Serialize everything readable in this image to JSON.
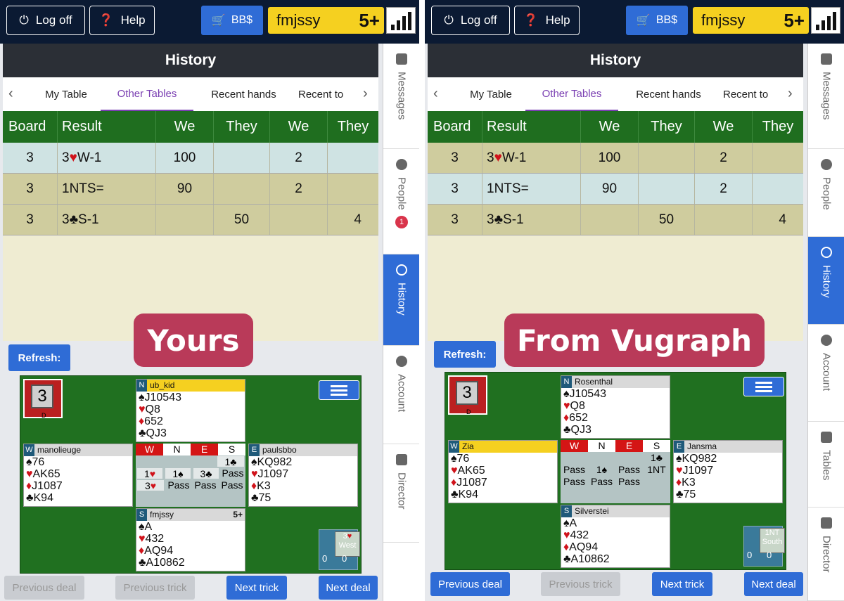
{
  "top": {
    "logoff": "Log off",
    "help": "Help",
    "bb": "BB$",
    "username": "fmjssy",
    "rank": "5+"
  },
  "history_title": "History",
  "tabs": [
    "My Table",
    "Other Tables",
    "Recent hands",
    "Recent to"
  ],
  "columns": [
    "Board",
    "Result",
    "We",
    "They",
    "We",
    "They"
  ],
  "sidebar": {
    "messages": "Messages",
    "people": "People",
    "people_badge": "1",
    "history": "History",
    "account": "Account",
    "tables": "Tables",
    "director": "Director"
  },
  "left": {
    "overlay": "Yours",
    "rows": [
      {
        "board": "3",
        "result": "3♥W-1",
        "we": "100",
        "they": "",
        "we2": "2",
        "they2": "",
        "bg": "#cfe3e3"
      },
      {
        "board": "3",
        "result": "1NTS=",
        "we": "90",
        "they": "",
        "we2": "2",
        "they2": "",
        "bg": "#cfcc9e"
      },
      {
        "board": "3",
        "result": "3♣S-1",
        "we": "",
        "they": "50",
        "we2": "",
        "they2": "4",
        "bg": "#cfcc9e"
      }
    ],
    "refresh": "Refresh:",
    "board_num": "3",
    "board_letter": "D",
    "north": {
      "seat": "N",
      "name": "ub_kid",
      "lines": [
        "♠J10543",
        "♥Q8",
        "♦652",
        "♣QJ3"
      ]
    },
    "west": {
      "seat": "W",
      "name": "manolieuge",
      "lines": [
        "♠76",
        "♥AK65",
        "♦J1087",
        "♣K94"
      ]
    },
    "east": {
      "seat": "E",
      "name": "paulsbbo",
      "lines": [
        "♠KQ982",
        "♥J1097",
        "♦K3",
        "♣75"
      ]
    },
    "south": {
      "seat": "S",
      "name": "fmjssy",
      "rank": "5+",
      "lines": [
        "♠A",
        "♥432",
        "♦AQ94",
        "♣A10862"
      ]
    },
    "bid_head": [
      "W",
      "N",
      "E",
      "S"
    ],
    "bids": [
      [
        "",
        "",
        "",
        "1♣"
      ],
      [
        "1♥",
        "1♠",
        "3♣",
        "Pass"
      ],
      [
        "3♥",
        "Pass",
        "Pass",
        "Pass"
      ]
    ],
    "contract": "3♥",
    "declarer": "West",
    "score_a": "0",
    "score_b": "0",
    "buttons": [
      "Previous deal",
      "Previous trick",
      "Next trick",
      "Next deal"
    ]
  },
  "right": {
    "overlay": "From Vugraph",
    "rows": [
      {
        "board": "3",
        "result": "3♥W-1",
        "we": "100",
        "they": "",
        "we2": "2",
        "they2": "",
        "bg": "#cfcc9e"
      },
      {
        "board": "3",
        "result": "1NTS=",
        "we": "90",
        "they": "",
        "we2": "2",
        "they2": "",
        "bg": "#cfe3e3"
      },
      {
        "board": "3",
        "result": "3♣S-1",
        "we": "",
        "they": "50",
        "we2": "",
        "they2": "4",
        "bg": "#cfcc9e"
      }
    ],
    "refresh": "Refresh:",
    "board_num": "3",
    "board_letter": "D",
    "north": {
      "seat": "N",
      "name": "Rosenthal",
      "lines": [
        "♠J10543",
        "♥Q8",
        "♦652",
        "♣QJ3"
      ]
    },
    "west": {
      "seat": "W",
      "name": "Zia",
      "lines": [
        "♠76",
        "♥AK65",
        "♦J1087",
        "♣K94"
      ]
    },
    "east": {
      "seat": "E",
      "name": "Jansma",
      "lines": [
        "♠KQ982",
        "♥J1097",
        "♦K3",
        "♣75"
      ]
    },
    "south": {
      "seat": "S",
      "name": "Silverstei",
      "rank": "",
      "lines": [
        "♠A",
        "♥432",
        "♦AQ94",
        "♣A10862"
      ]
    },
    "bid_head": [
      "W",
      "N",
      "E",
      "S"
    ],
    "bids": [
      [
        "",
        "",
        "",
        "1♣"
      ],
      [
        "Pass",
        "1♠",
        "Pass",
        "1NT"
      ],
      [
        "Pass",
        "Pass",
        "Pass",
        ""
      ]
    ],
    "contract": "1NT",
    "declarer": "South",
    "score_a": "0",
    "score_b": "0",
    "buttons": [
      "Previous deal",
      "Previous trick",
      "Next trick",
      "Next deal"
    ]
  }
}
